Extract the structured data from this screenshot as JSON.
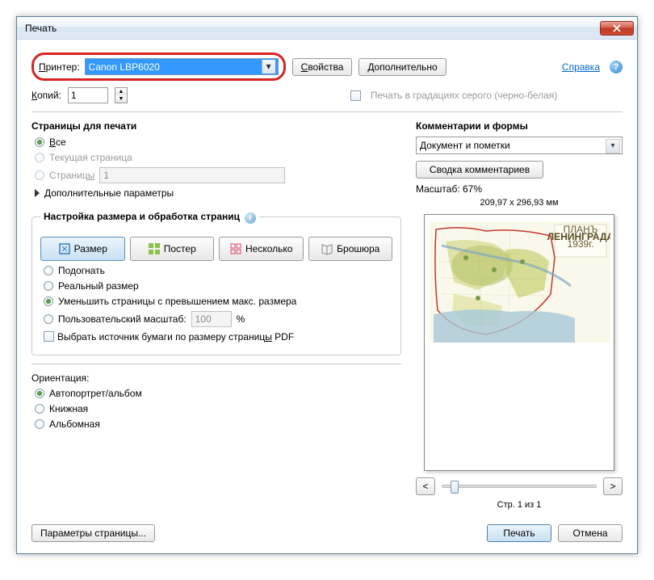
{
  "title": "Печать",
  "printer": {
    "label": "Принтер:",
    "value": "Canon LBP6020"
  },
  "properties_btn": "Свойства",
  "advanced_btn": "Дополнительно",
  "help_link": "Справка",
  "copies": {
    "label": "Копий:",
    "value": "1"
  },
  "grayscale": "Печать в градациях серого (черно-белая)",
  "pages_section": {
    "title": "Страницы для печати",
    "all": "Все",
    "current": "Текущая страница",
    "pages": "Страницы",
    "pages_value": "1",
    "more": "Дополнительные параметры"
  },
  "size_section": {
    "title": "Настройка размера и обработка страниц",
    "tabs": {
      "size": "Размер",
      "poster": "Постер",
      "multiple": "Несколько",
      "booklet": "Брошюра"
    },
    "fit": "Подогнать",
    "actual": "Реальный размер",
    "shrink": "Уменьшить страницы с превышением макс. размера",
    "custom": "Пользовательский масштаб:",
    "custom_value": "100",
    "percent": "%",
    "paper_source": "Выбрать источник бумаги по размеру страницы PDF"
  },
  "orientation": {
    "title": "Ориентация:",
    "auto": "Автопортрет/альбом",
    "portrait": "Книжная",
    "landscape": "Альбомная"
  },
  "comments": {
    "title": "Комментарии и формы",
    "value": "Документ и пометки",
    "summary_btn": "Сводка комментариев"
  },
  "preview": {
    "scale": "Масштаб:  67%",
    "dimensions": "209,97 x 296,93 мм",
    "map_title1": "ПЛАНЪ",
    "map_title2": "ЛЕНИНГРАДА",
    "map_title3": "1939г.",
    "page_info": "Стр. 1 из 1",
    "prev": "<",
    "next": ">"
  },
  "footer": {
    "page_setup": "Параметры страницы...",
    "print": "Печать",
    "cancel": "Отмена"
  }
}
